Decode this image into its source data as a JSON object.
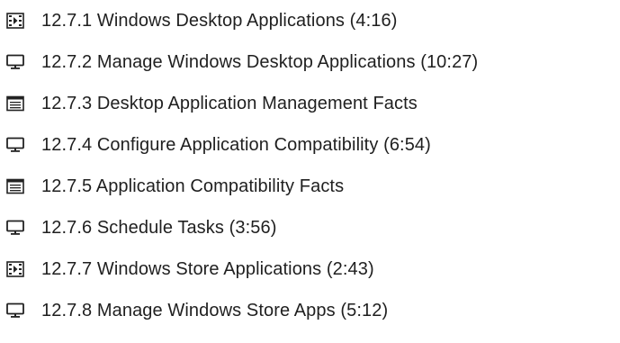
{
  "lesson_list": {
    "items": [
      {
        "icon": "video-icon",
        "label": "12.7.1 Windows Desktop Applications (4:16)"
      },
      {
        "icon": "monitor-icon",
        "label": "12.7.2 Manage Windows Desktop Applications (10:27)"
      },
      {
        "icon": "document-icon",
        "label": "12.7.3 Desktop Application Management Facts"
      },
      {
        "icon": "monitor-icon",
        "label": "12.7.4 Configure Application Compatibility (6:54)"
      },
      {
        "icon": "document-icon",
        "label": "12.7.5 Application Compatibility Facts"
      },
      {
        "icon": "monitor-icon",
        "label": "12.7.6 Schedule Tasks (3:56)"
      },
      {
        "icon": "video-icon",
        "label": "12.7.7 Windows Store Applications (2:43)"
      },
      {
        "icon": "monitor-icon",
        "label": "12.7.8 Manage Windows Store Apps (5:12)"
      }
    ]
  },
  "colors": {
    "text": "#1f1f1f",
    "icon": "#222222"
  }
}
